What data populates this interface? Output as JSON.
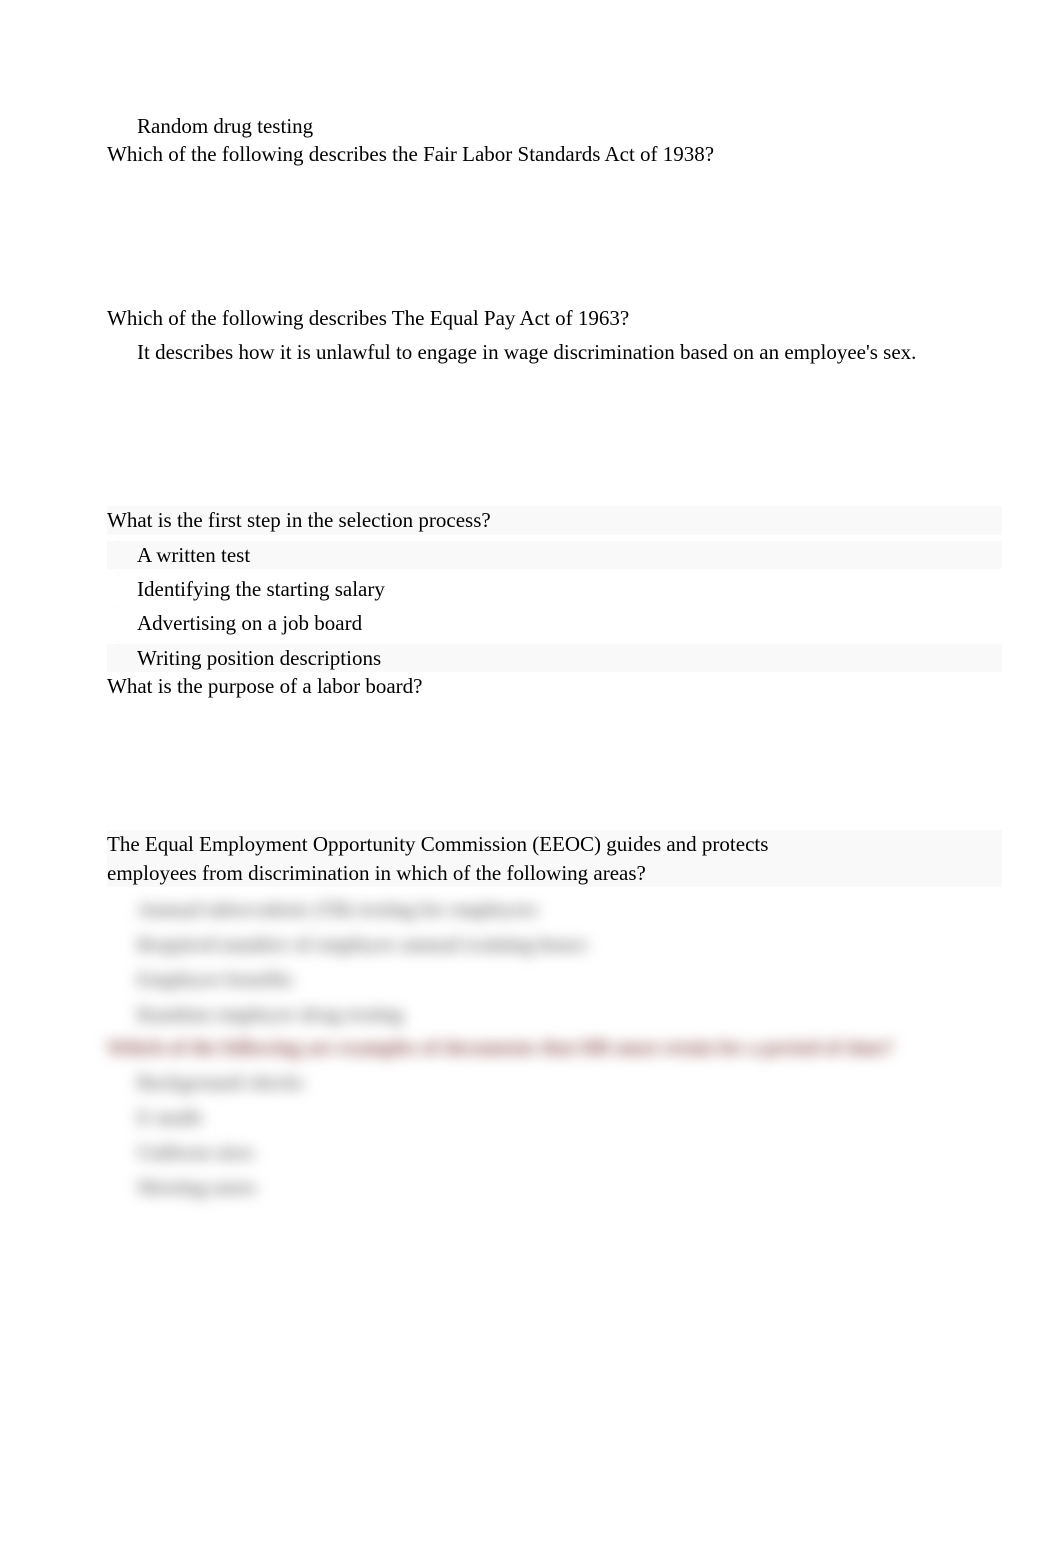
{
  "lines": {
    "drug_testing": "Random drug testing",
    "q_flsa": "Which of the following describes the Fair Labor Standards Act of 1938?",
    "q_epa": "Which of the following describes The Equal Pay Act of 1963?",
    "epa_answer": "It describes how it is unlawful to engage in wage discrimination based on an employee's sex.",
    "q_selection": "What is the first step in the selection process?",
    "sel_opt_a": "A written test",
    "sel_opt_b": "Identifying the starting salary",
    "sel_opt_c": "Advertising on a job board",
    "sel_opt_d": "Writing position descriptions",
    "q_labor_board": "What is the purpose of a labor board?",
    "q_eeoc_1": "The Equal Employment Opportunity Commission (EEOC) guides and protects",
    "q_eeoc_2": "employees from discrimination in which of the following areas?"
  },
  "blurred": {
    "opt1": "Annual tuberculosis (TB) testing for employees",
    "opt2": "Required number of employee annual training hours",
    "opt3": "Employee benefits",
    "opt4": "Random employee drug testing",
    "q2": "Which of the following are examples of documents that HR must retain for a period of time?",
    "b1": "Background checks",
    "b2": "E-mails",
    "b3": "Uniform sizes",
    "b4": "Meeting notes"
  }
}
